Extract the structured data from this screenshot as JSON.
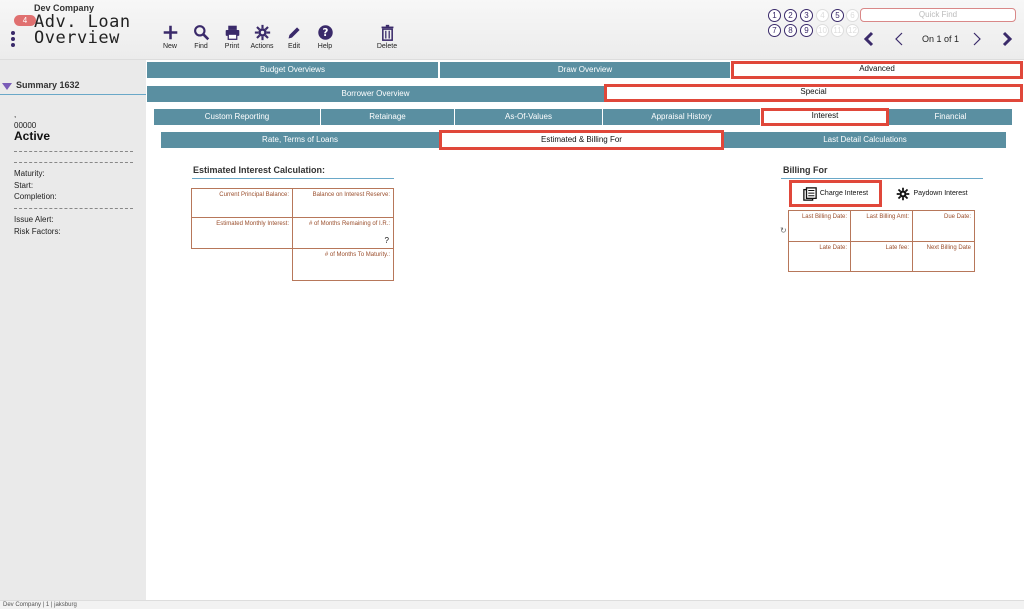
{
  "header": {
    "company": "Dev Company",
    "badge_count": "4",
    "title_line1": "Adv. Loan",
    "title_line2": "Overview",
    "tools": [
      {
        "name": "new",
        "label": "New",
        "icon": "plus-icon"
      },
      {
        "name": "find",
        "label": "Find",
        "icon": "search-icon"
      },
      {
        "name": "print",
        "label": "Print",
        "icon": "printer-icon"
      },
      {
        "name": "actions",
        "label": "Actions",
        "icon": "gear-icon"
      },
      {
        "name": "edit",
        "label": "Edit",
        "icon": "pencil-icon"
      },
      {
        "name": "help",
        "label": "Help",
        "icon": "help-icon"
      },
      {
        "name": "delete",
        "label": "Delete",
        "icon": "trash-icon"
      }
    ],
    "number_buttons": [
      "1",
      "2",
      "3",
      "4",
      "5",
      "6",
      "7",
      "8",
      "9",
      "10",
      "11",
      "12"
    ],
    "quick_find_placeholder": "Quick Find",
    "record_indicator": "On 1 of 1"
  },
  "sidebar": {
    "summary_label": "Summary 1632",
    "comma": ",",
    "loan_number": "00000",
    "status": "Active",
    "maturity_label": "Maturity:",
    "start_label": "Start:",
    "completion_label": "Completion:",
    "issue_alert_label": "Issue Alert:",
    "risk_factors_label": "Risk Factors:"
  },
  "tabs": {
    "row1": [
      "Budget Overviews",
      "Draw Overview",
      "Advanced"
    ],
    "row2": [
      "Borrower Overview",
      "Special"
    ],
    "row3": [
      "Custom Reporting",
      "Retainage",
      "As-Of-Values",
      "Appraisal History",
      "Interest",
      "Financial"
    ],
    "row4": [
      "Rate, Terms of Loans",
      "Estimated & Billing For",
      "Last Detail Calculations"
    ]
  },
  "estimated": {
    "title": "Estimated Interest Calculation:",
    "current_principal": "Current Principal Balance:",
    "balance_reserve": "Balance on Interest Reserve:",
    "est_monthly": "Estimated Monthly Interest:",
    "months_remaining": "# of Months Remaining of I.R.:",
    "months_remaining_value": "?",
    "months_maturity": "# of Months To Maturity.:"
  },
  "billing": {
    "title": "Billing For",
    "charge_label": "Charge Interest",
    "paydown_label": "Paydown Interest",
    "last_billing_date": "Last Billing Date:",
    "last_billing_amt": "Last Billing Amt:",
    "due_date": "Due Date:",
    "late_date": "Late Date:",
    "late_fee": "Late fee:",
    "next_billing_date": "Next Billing Date"
  },
  "footer": {
    "text": "Dev Company | 1 | jaksburg"
  },
  "colors": {
    "tab_bg": "#5a8fa1",
    "highlight": "#e0473a",
    "accent_purple": "#3a2a6a",
    "cell_border": "#b7775a"
  }
}
